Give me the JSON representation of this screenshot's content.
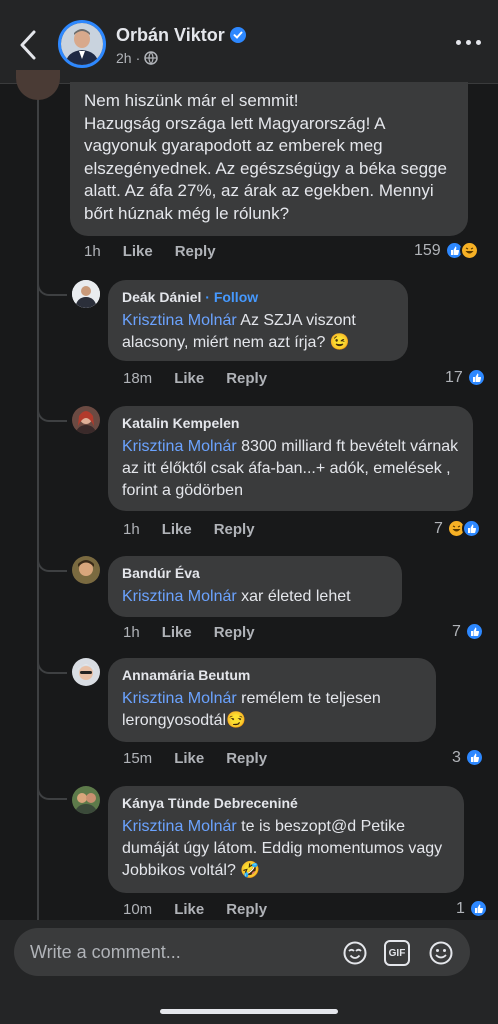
{
  "header": {
    "name": "Orbán Viktor",
    "time": "2h",
    "back_icon": "chevron-left-icon",
    "more_icon": "more-horizontal-icon"
  },
  "main_comment": {
    "text": "Nem hiszünk már el semmit!\nHazugság országa lett Magyarország! A vagyonuk gyarapodott az emberek meg elszegényednek. Az egészségügy a béka segge alatt. Az áfa 27%, az árak az egekben. Mennyi bőrt húznak még le rólunk?",
    "time": "1h",
    "like_label": "Like",
    "reply_label": "Reply",
    "reactions": "159"
  },
  "replies": [
    {
      "author": "Deák Dániel",
      "follow": "· Follow",
      "mention": "Krisztina Molnár",
      "text": " Az SZJA viszont alacsony, miért nem azt írja? 😉",
      "time": "18m",
      "like_label": "Like",
      "reply_label": "Reply",
      "reactions": "17"
    },
    {
      "author": "Katalin Kempelen",
      "mention": "Krisztina Molnár",
      "text": " 8300 milliard ft bevételt várnak az itt élőktől csak áfa-ban...+ adók, emelések , forint a gödörben",
      "time": "1h",
      "like_label": "Like",
      "reply_label": "Reply",
      "reactions": "7"
    },
    {
      "author": "Bandúr Éva",
      "mention": "Krisztina Molnár",
      "text": " xar életed lehet",
      "time": "1h",
      "like_label": "Like",
      "reply_label": "Reply",
      "reactions": "7"
    },
    {
      "author": "Annamária Beutum",
      "mention": "Krisztina Molnár",
      "text": " remélem te teljesen lerongyosodtál😏",
      "time": "15m",
      "like_label": "Like",
      "reply_label": "Reply",
      "reactions": "3"
    },
    {
      "author": "Kánya Tünde Debreceniné",
      "mention": "Krisztina Molnár",
      "text": " te is beszopt@d Petike dumáját úgy látom. Eddig momentumos vagy Jobbikos voltál? 🤣",
      "time": "10m",
      "like_label": "Like",
      "reply_label": "Reply",
      "reactions": "1"
    }
  ],
  "composer": {
    "placeholder": "Write a comment...",
    "icons": [
      "avatar-sticker-icon",
      "gif-icon",
      "emoji-icon"
    ],
    "gif_label": "GIF"
  },
  "colors": {
    "background": "#18191a",
    "bubble": "#3a3b3c",
    "accent": "#2d88ff",
    "mention": "#6ba3ff"
  }
}
